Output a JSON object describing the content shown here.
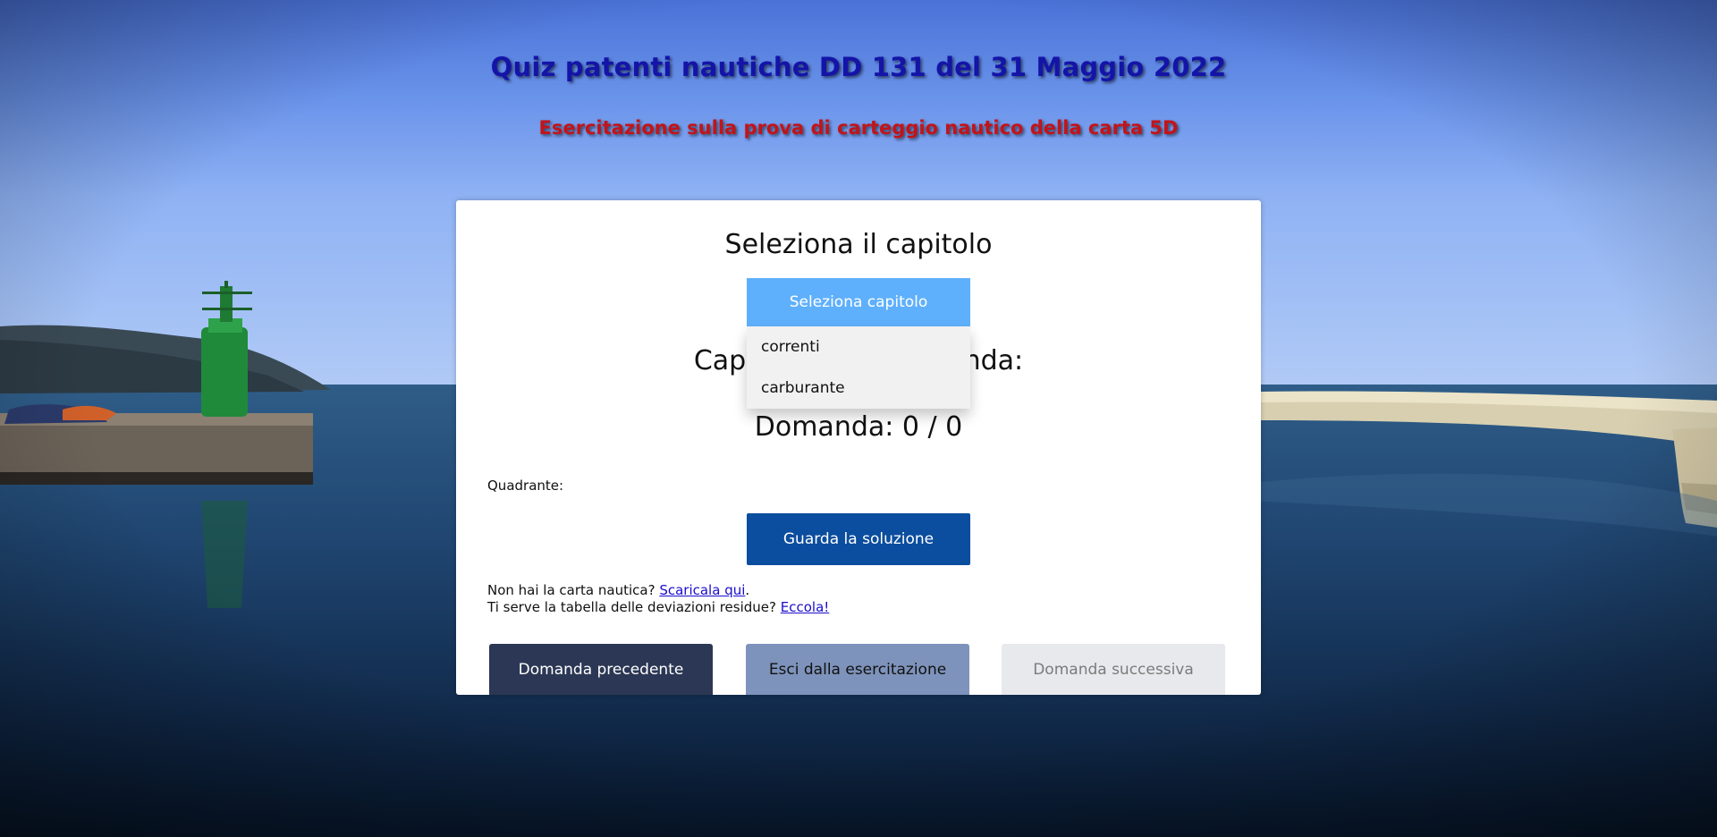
{
  "header": {
    "title": "Quiz patenti nautiche DD 131 del 31 Maggio 2022",
    "subtitle": "Esercitazione sulla prova di carteggio nautico della carta 5D"
  },
  "card": {
    "heading": "Seleziona il capitolo",
    "select_button": "Seleziona capitolo",
    "dropdown_options": [
      "correnti",
      "carburante"
    ],
    "chapter_label": "Capitolo:",
    "question_label": "Domanda:",
    "question_counter": "Domanda: 0 / 0",
    "quadrant_label": "Quadrante:",
    "solution_button": "Guarda la soluzione",
    "info": {
      "line1_text": "Non hai la carta nautica?",
      "line1_link": "Scaricala qui",
      "line1_after": ".",
      "line2_text": "Ti serve la tabella delle deviazioni residue?",
      "line2_link": "Eccola!"
    },
    "nav": {
      "prev": "Domanda precedente",
      "exit": "Esci dalla esercitazione",
      "next": "Domanda successiva"
    }
  },
  "colors": {
    "title": "#1414a8",
    "subtitle": "#c2141a",
    "select_button": "#5fb0fc",
    "solution_button": "#0b4d9e",
    "prev_button": "#2b3754",
    "exit_button": "#7e93bb",
    "next_button_disabled": "#e8e9ec"
  }
}
